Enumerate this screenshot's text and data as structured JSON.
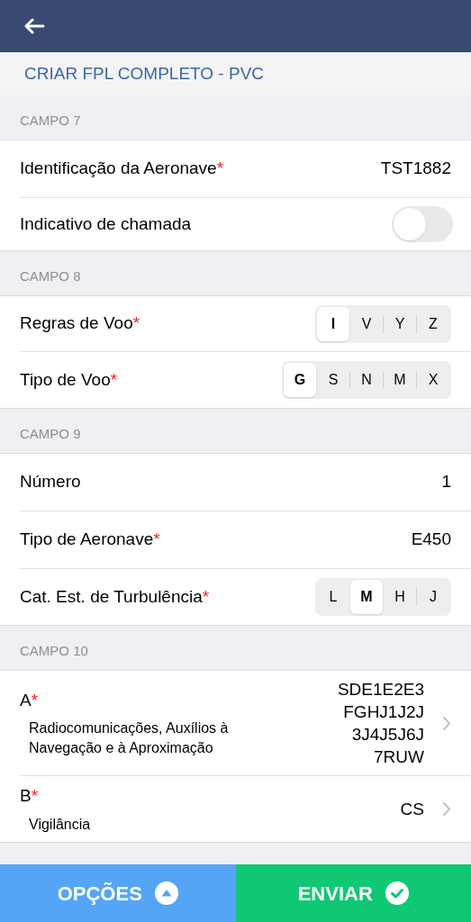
{
  "title": "CRIAR FPL COMPLETO - PVC",
  "sections": [
    {
      "title": "CAMPO 7",
      "rows": [
        {
          "kind": "value",
          "label": "Identificação da Aeronave",
          "required_mark": "*",
          "value": "TST1882"
        },
        {
          "kind": "toggle",
          "label": "Indicativo de chamada",
          "on": false
        }
      ]
    },
    {
      "title": "CAMPO 8",
      "rows": [
        {
          "kind": "segmented",
          "label": "Regras de Voo",
          "required_mark": "*",
          "options": [
            {
              "label": "I",
              "selected": true
            },
            {
              "label": "V",
              "selected": false
            },
            {
              "label": "Y",
              "selected": false
            },
            {
              "label": "Z",
              "selected": false
            }
          ]
        },
        {
          "kind": "segmented",
          "label": "Tipo de Voo",
          "required_mark": "*",
          "options": [
            {
              "label": "G",
              "selected": true
            },
            {
              "label": "S",
              "selected": false
            },
            {
              "label": "N",
              "selected": false
            },
            {
              "label": "M",
              "selected": false
            },
            {
              "label": "X",
              "selected": false
            }
          ]
        }
      ]
    },
    {
      "title": "CAMPO 9",
      "rows": [
        {
          "kind": "value",
          "label": "Número",
          "value": "1"
        },
        {
          "kind": "value",
          "label": "Tipo de Aeronave",
          "required_mark": "*",
          "value": "E450"
        },
        {
          "kind": "segmented",
          "label": "Cat. Est. de Turbulência",
          "required_mark": "*",
          "options": [
            {
              "label": "L",
              "selected": false
            },
            {
              "label": "M",
              "selected": true
            },
            {
              "label": "H",
              "selected": false
            },
            {
              "label": "J",
              "selected": false
            }
          ]
        }
      ]
    },
    {
      "title": "CAMPO 10",
      "rows": [
        {
          "kind": "detail",
          "label": "A",
          "required_mark": "*",
          "description": "Radiocomunicações, Auxílios à Navegação e à Aproximação",
          "value_lines": [
            "SDE1E2E3",
            "FGHJ1J2J",
            "3J4J5J6J",
            "7RUW"
          ]
        },
        {
          "kind": "detail",
          "label": "B",
          "required_mark": "*",
          "description": "Vigilância",
          "value_lines": [
            "CS"
          ]
        }
      ]
    }
  ],
  "footer": {
    "options_button": "OPÇÕES",
    "send_button": "ENVIAR"
  }
}
